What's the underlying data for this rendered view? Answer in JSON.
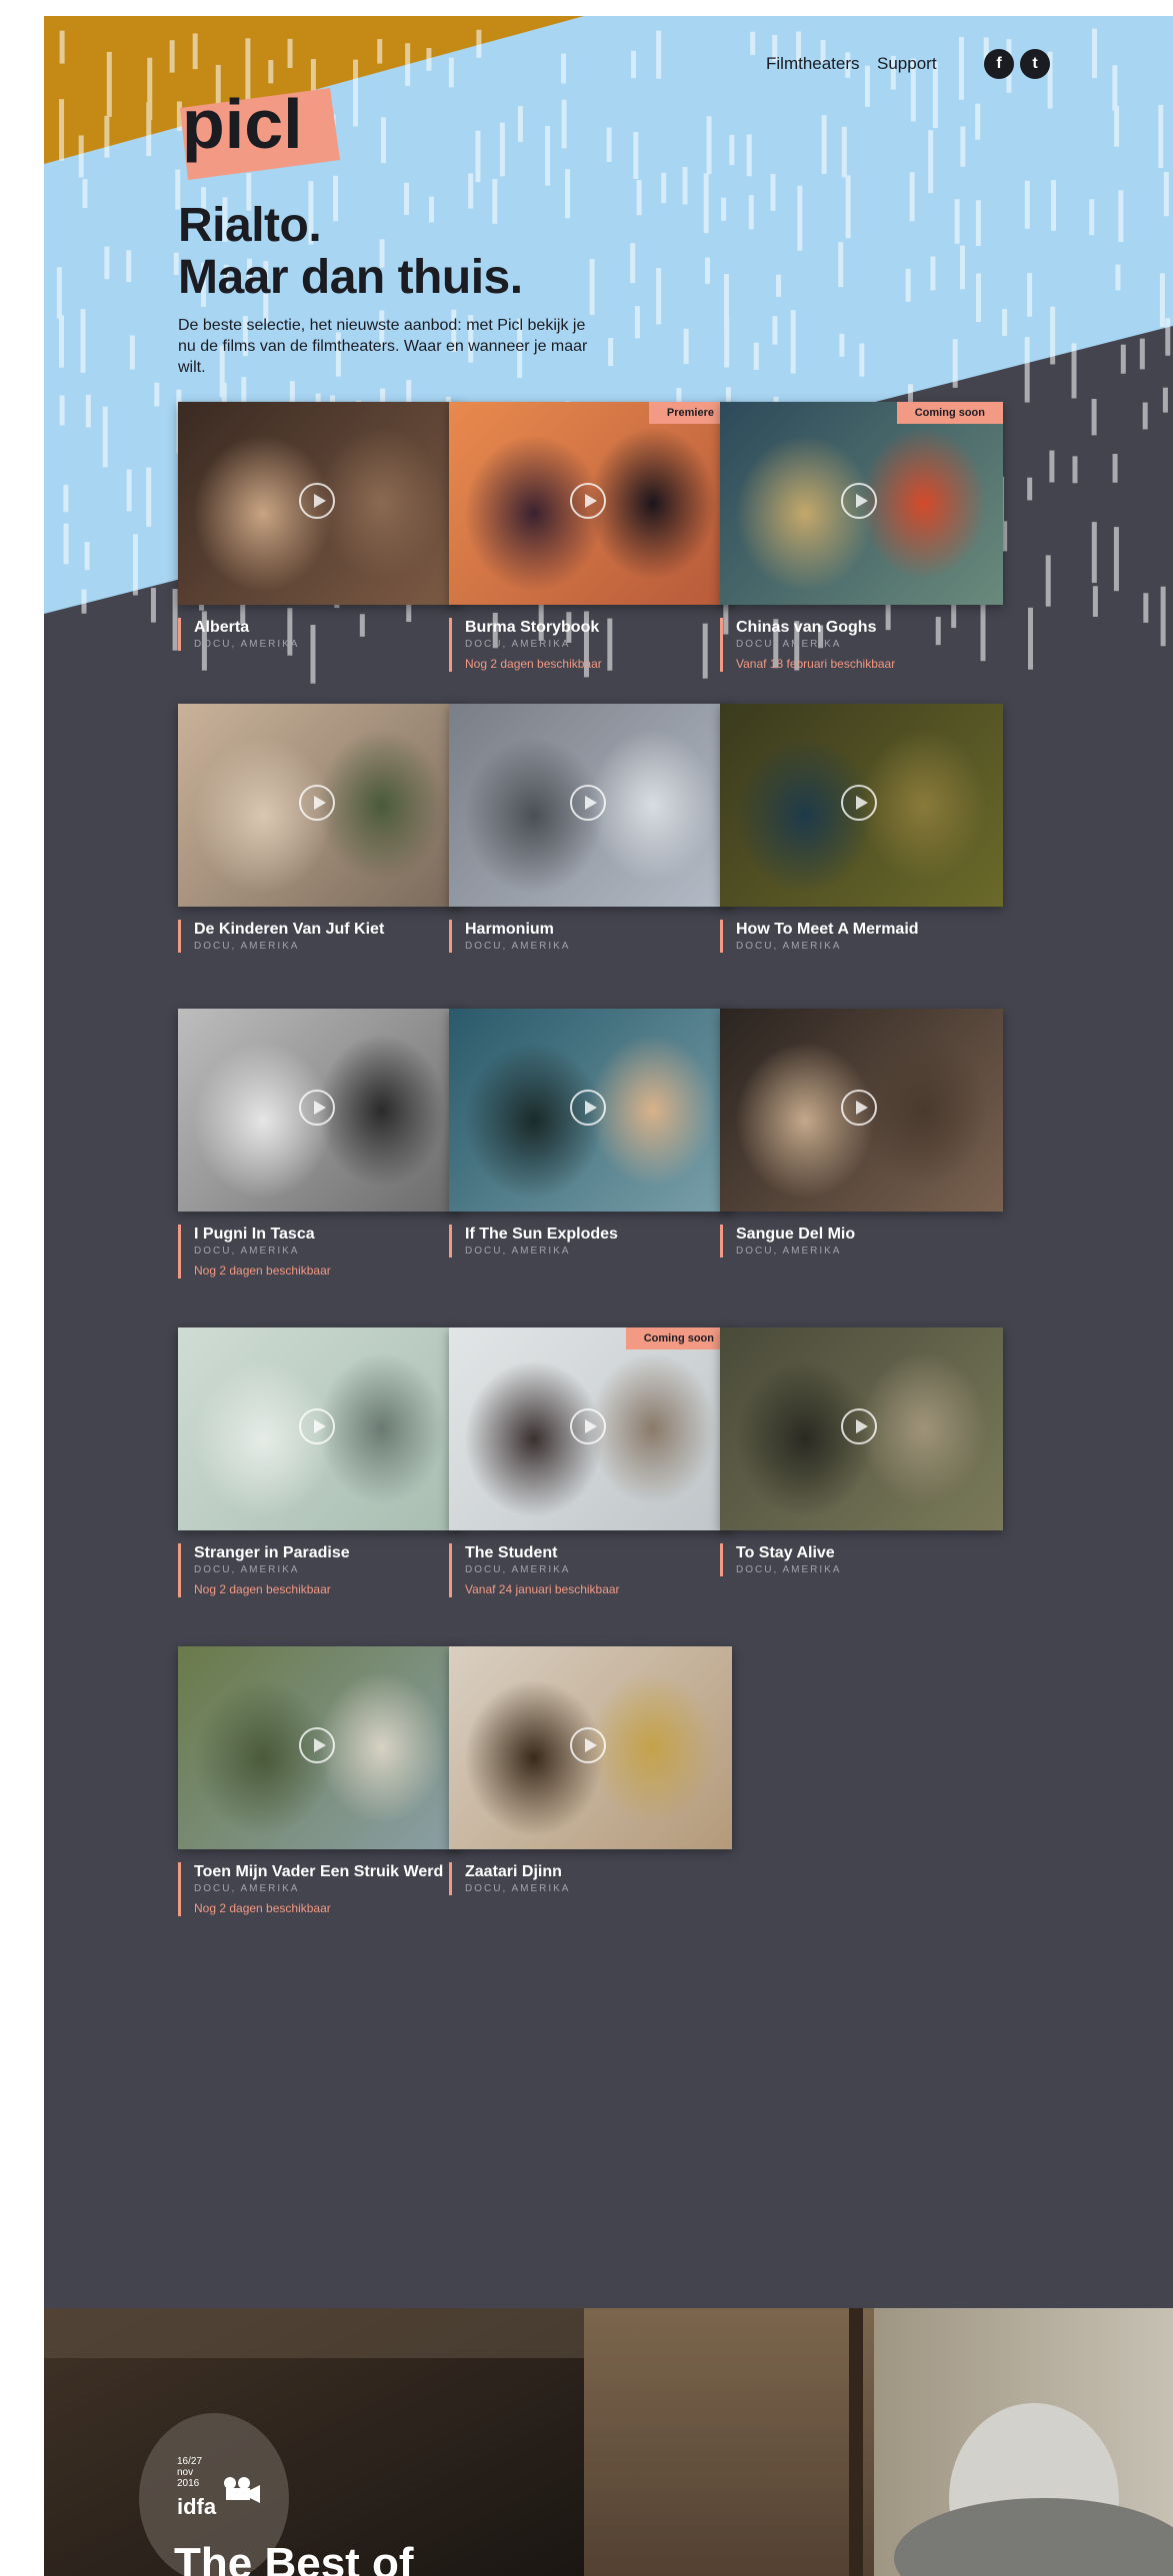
{
  "brand": {
    "logo_text": "picl"
  },
  "nav": {
    "filmtheaters": "Filmtheaters",
    "support": "Support"
  },
  "social": {
    "facebook": "f",
    "twitter": "t"
  },
  "hero": {
    "headline_line1": "Rialto.",
    "headline_line2": "Maar dan thuis.",
    "intro": "De beste selectie, het nieuwste aanbod: met Picl bekijk je nu de films van de filmtheaters. Waar en wanneer je maar wilt."
  },
  "films": [
    {
      "title": "Alberta",
      "genre": "DOCU, AMERIKA",
      "badge": "",
      "availability": ""
    },
    {
      "title": "Burma Storybook",
      "genre": "DOCU, AMERIKA",
      "badge": "Premiere",
      "availability": "Nog 2 dagen beschikbaar"
    },
    {
      "title": "Chinas van Goghs",
      "genre": "DOCU, AMERIKA",
      "badge": "Coming soon",
      "availability": "Vanaf 18 februari beschikbaar"
    },
    {
      "title": "De Kinderen Van Juf Kiet",
      "genre": "DOCU, AMERIKA",
      "badge": "",
      "availability": ""
    },
    {
      "title": "Harmonium",
      "genre": "DOCU, AMERIKA",
      "badge": "",
      "availability": ""
    },
    {
      "title": "How To Meet A Mermaid",
      "genre": "DOCU, AMERIKA",
      "badge": "",
      "availability": ""
    },
    {
      "title": "I Pugni In Tasca",
      "genre": "DOCU, AMERIKA",
      "badge": "",
      "availability": "Nog 2 dagen beschikbaar"
    },
    {
      "title": "If The Sun Explodes",
      "genre": "DOCU, AMERIKA",
      "badge": "",
      "availability": ""
    },
    {
      "title": "Sangue Del Mio",
      "genre": "DOCU, AMERIKA",
      "badge": "",
      "availability": ""
    },
    {
      "title": "Stranger in Paradise",
      "genre": "DOCU, AMERIKA",
      "badge": "",
      "availability": "Nog 2 dagen beschikbaar"
    },
    {
      "title": "The Student",
      "genre": "DOCU, AMERIKA",
      "badge": "Coming soon",
      "availability": "Vanaf 24 januari beschikbaar"
    },
    {
      "title": "To Stay Alive",
      "genre": "DOCU, AMERIKA",
      "badge": "",
      "availability": ""
    },
    {
      "title": "Toen Mijn Vader Een Struik Werd",
      "genre": "DOCU, AMERIKA",
      "badge": "",
      "availability": "Nog 2 dagen beschikbaar"
    },
    {
      "title": "Zaatari Djinn",
      "genre": "DOCU, AMERIKA",
      "badge": "",
      "availability": ""
    }
  ],
  "festival": {
    "dates_line1": "16/27",
    "dates_line2": "nov",
    "dates_line3": "2016",
    "logo_text": "idfa",
    "heading": "The Best of"
  },
  "colors": {
    "sky": "#a7d5f2",
    "gold": "#c48a15",
    "panel": "#44444f",
    "accent": "#f29a84",
    "ink": "#1b1b22"
  }
}
